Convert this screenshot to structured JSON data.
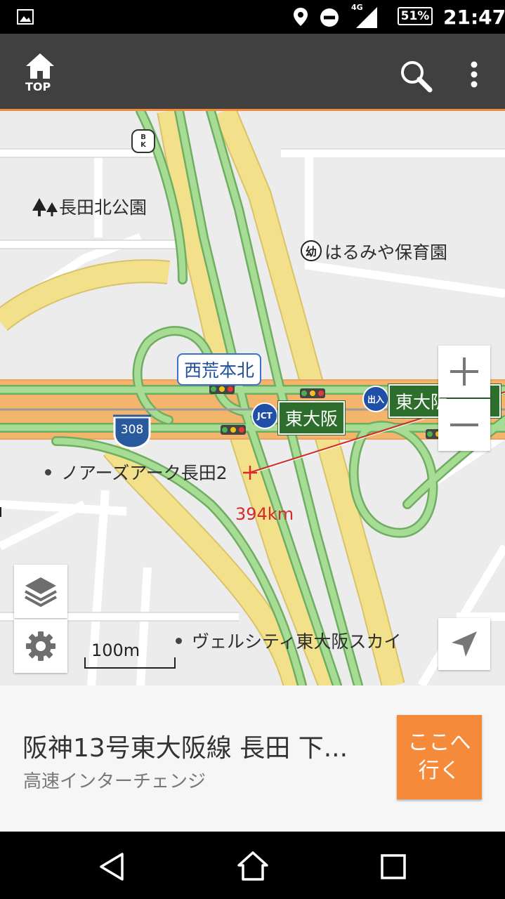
{
  "status_bar": {
    "network": "4G",
    "battery": "51%",
    "time": "21:47"
  },
  "app_bar": {
    "home_label": "TOP"
  },
  "map": {
    "labels": {
      "park": "長田北公園",
      "kindergarten": "はるみや保育園",
      "intersection": "西荒本北",
      "jct_badge": "JCT",
      "exit_badge": "出入",
      "junction_sign": "東大阪",
      "exit_sign": "東大阪",
      "route_number": "308",
      "bk_mark": "BK",
      "kindergarten_mark": "幼",
      "poi1": "ノアーズアーク長田2",
      "poi2": "ヴェルシティ東大阪スカイ",
      "distance": "394km",
      "scale": "100m"
    }
  },
  "bottom_sheet": {
    "title": "阪神13号東大阪線 長田 下...",
    "subtitle": "高速インターチェンジ",
    "go_button_line1": "ここへ",
    "go_button_line2": "行く"
  },
  "colors": {
    "accent_orange": "#f58a3a",
    "highway_green": "#8ccb7a",
    "road_yellow": "#f3e08a"
  }
}
